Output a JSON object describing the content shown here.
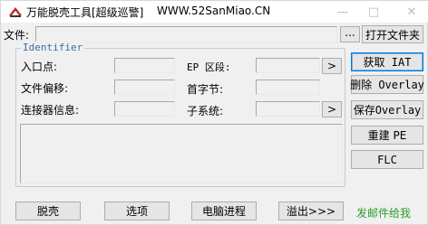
{
  "window": {
    "title": "万能脱壳工具[超级巡警]",
    "site": "WWW.52SanMiao.CN",
    "controls": {
      "minimize": "—",
      "maximize": "□",
      "close": "✕"
    }
  },
  "file": {
    "label": "文件:",
    "value": "",
    "browse_label": "...",
    "open_label": "打开文件夹"
  },
  "identifier": {
    "legend": "Identifier",
    "entry_point_label": "入口点:",
    "file_offset_label": "文件偏移:",
    "linker_label": "连接器信息:",
    "ep_section_label": "EP 区段:",
    "first_byte_label": "首字节:",
    "subsystem_label": "子系统:",
    "more_label": ">",
    "entry_point": "",
    "file_offset": "",
    "linker": "",
    "ep_section": "",
    "first_byte": "",
    "subsystem": ""
  },
  "side_buttons": {
    "get_iat": "获取 IAT",
    "delete_overlay": "删除 Overlay",
    "save_overlay": "保存Overlay",
    "rebuild_pe": "重建 PE",
    "flc": "FLC"
  },
  "bottom_buttons": {
    "unpack": "脱壳",
    "options": "选项",
    "process": "电脑进程",
    "overflow": "溢出>>>"
  },
  "footer": {
    "link": "发邮件给我"
  },
  "colors": {
    "link": "#2e9b2e",
    "focus": "#0078d7",
    "legend": "#3a6ea5"
  }
}
